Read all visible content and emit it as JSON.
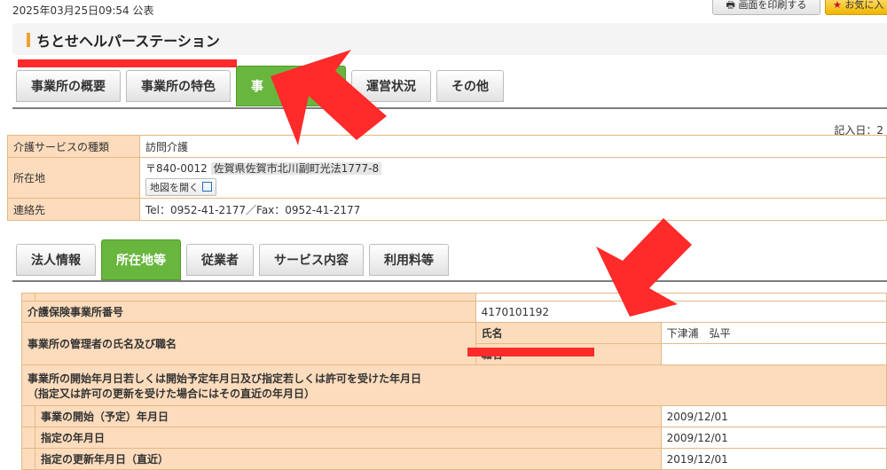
{
  "header": {
    "published": "2025年03月25日09:54 公表",
    "print_button": "画面を印刷する",
    "favorite_button": "お気に入",
    "title": "ちとせヘルパーステーション"
  },
  "main_tabs": [
    {
      "label": "事業所の概要",
      "active": false
    },
    {
      "label": "事業所の特色",
      "active": false
    },
    {
      "label": "事",
      "active": true
    },
    {
      "label": "運営状況",
      "active": false
    },
    {
      "label": "その他",
      "active": false
    }
  ],
  "write_date": "記入日：2",
  "info": {
    "service_type_label": "介護サービスの種類",
    "service_type": "訪問介護",
    "address_label": "所在地",
    "postal": "〒840-0012",
    "address": "佐賀県佐賀市北川副町光法1777-8",
    "map_button": "地図を開く",
    "contact_label": "連絡先",
    "contact": "Tel：0952-41-2177／Fax：0952-41-2177"
  },
  "sub_tabs": [
    {
      "label": "法人情報",
      "active": false
    },
    {
      "label": "所在地等",
      "active": true
    },
    {
      "label": "従業者",
      "active": false
    },
    {
      "label": "サービス内容",
      "active": false
    },
    {
      "label": "利用料等",
      "active": false
    }
  ],
  "detail": {
    "office_number_label": "介護保険事業所番号",
    "office_number": "4170101192",
    "manager_label": "事業所の管理者の氏名及び職名",
    "name_label": "氏名",
    "name": "下津浦　弘平",
    "position_label": "職名",
    "start_heading_1": "事業所の開始年月日若しくは開始予定年月日及び指定若しくは許可を受けた年月日",
    "start_heading_2": "（指定又は許可の更新を受けた場合にはその直近の年月日）",
    "start_date_label": "事業の開始（予定）年月日",
    "start_date": "2009/12/01",
    "designation_label": "指定の年月日",
    "designation_date": "2009/12/01",
    "renewal_label": "指定の更新年月日（直近）",
    "renewal_date": "2019/12/01"
  },
  "colors": {
    "accent_green": "#69b63f",
    "label_bg": "#fcdcbc",
    "annotation_red": "#ff2a2a"
  }
}
